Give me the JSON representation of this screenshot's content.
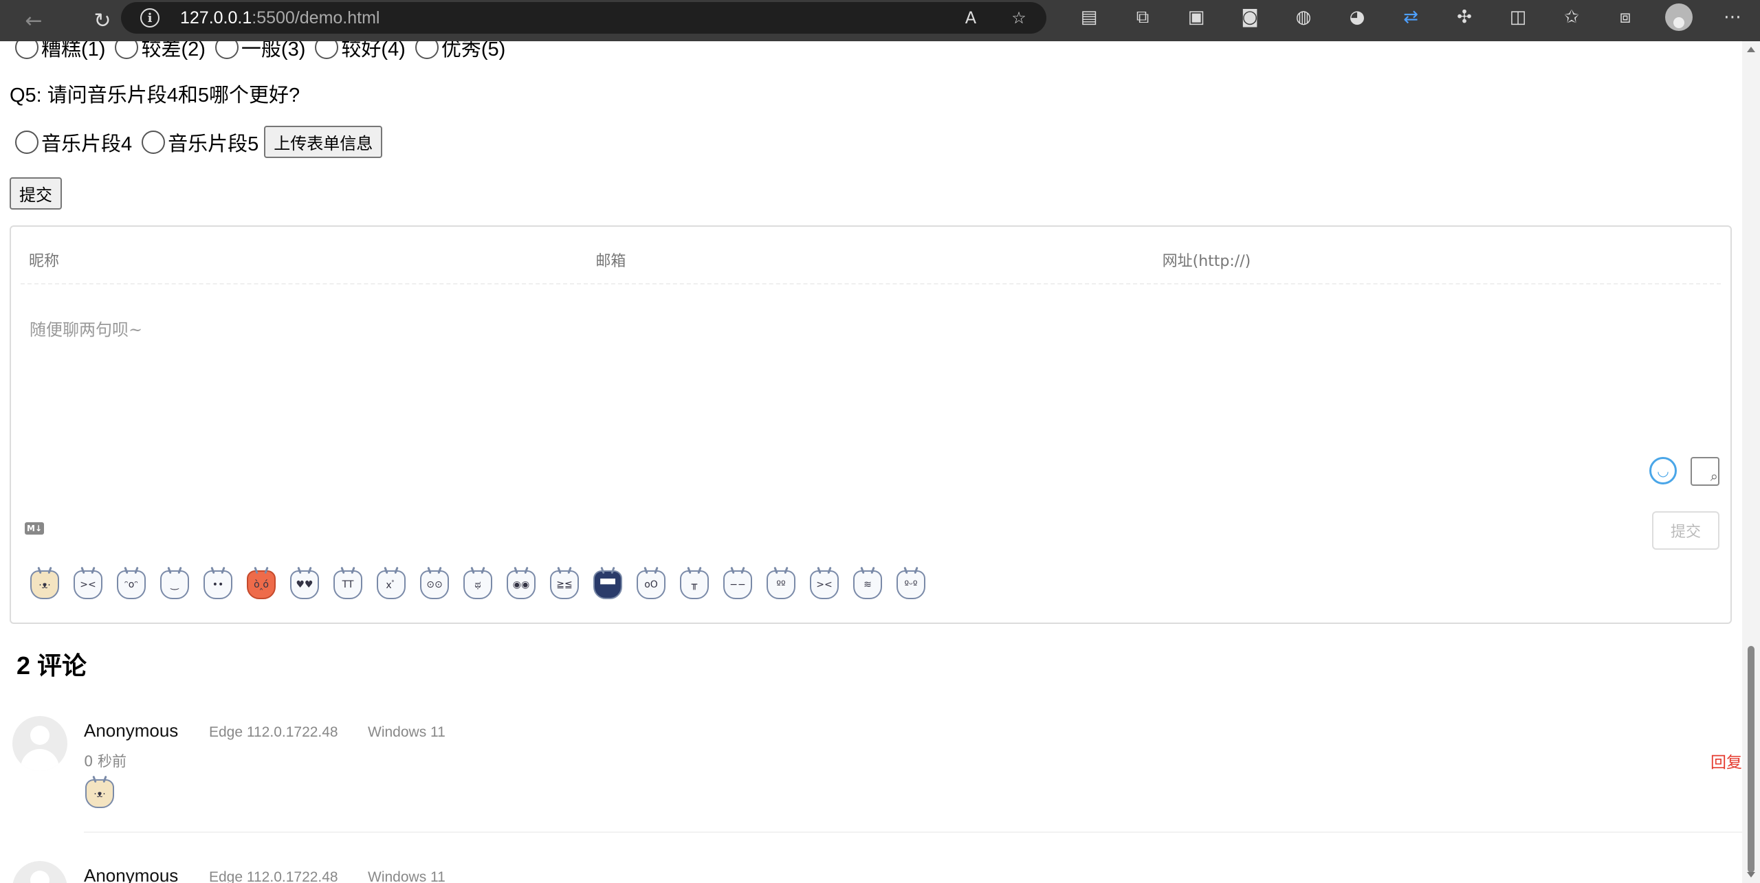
{
  "browser": {
    "url_host": "127.0.0.1",
    "url_rest": ":5500/demo.html"
  },
  "q4": {
    "options": [
      "糟糕(1)",
      "较差(2)",
      "一般(3)",
      "较好(4)",
      "优秀(5)"
    ]
  },
  "q5": {
    "title": "Q5: 请问音乐片段4和5哪个更好?",
    "options": [
      "音乐片段4",
      "音乐片段5"
    ],
    "upload_label": "上传表单信息"
  },
  "submit_label": "提交",
  "comment_form": {
    "nick_placeholder": "昵称",
    "mail_placeholder": "邮箱",
    "link_placeholder": "网址(http://)",
    "textarea_placeholder": "随便聊两句呗~",
    "submit_label": "提交",
    "md_badge": "M↓",
    "emojis": [
      "·ᴥ·",
      "><",
      "ᵔoᵔ",
      "‿",
      "••",
      "ò‸ó",
      "♥♥",
      "TT",
      "xﾟ",
      "⊙⊙",
      "ಥ",
      "◉◉",
      "≧≦",
      "▀▀",
      "oO",
      "╥",
      "−−",
      "ºº",
      "><",
      "≋",
      "ºᵕº"
    ]
  },
  "comments_count_label": "2 评论",
  "comments": [
    {
      "nick": "Anonymous",
      "browser": "Edge 112.0.1722.48",
      "os": "Windows 11",
      "time": "0 秒前",
      "reply": "回复"
    },
    {
      "nick": "Anonymous",
      "browser": "Edge 112.0.1722.48",
      "os": "Windows 11"
    }
  ]
}
